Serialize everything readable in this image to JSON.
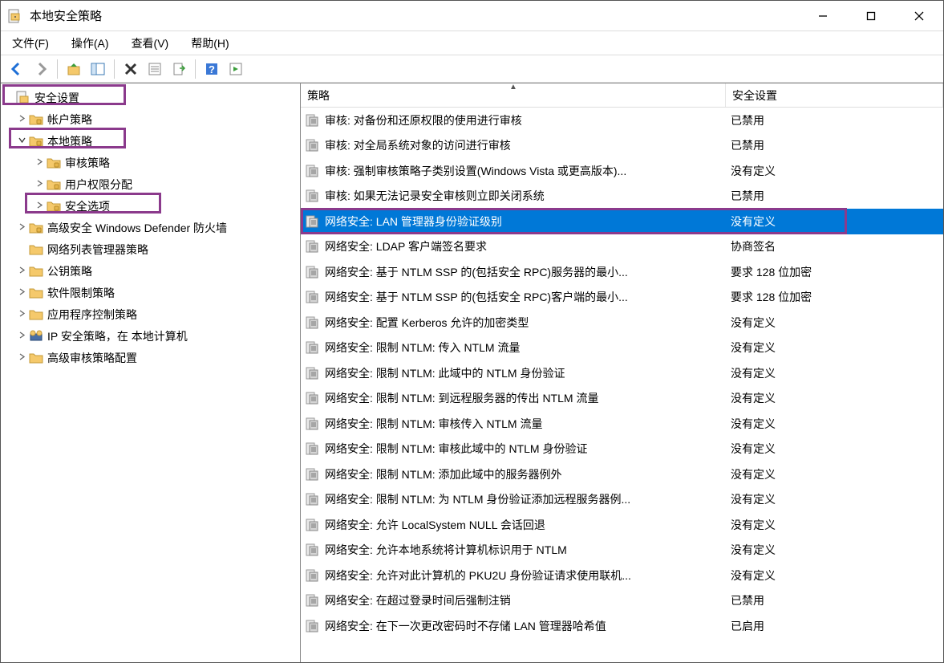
{
  "window": {
    "title": "本地安全策略"
  },
  "menu": {
    "file": "文件(F)",
    "action": "操作(A)",
    "view": "查看(V)",
    "help": "帮助(H)"
  },
  "columns": {
    "policy": "策略",
    "setting": "安全设置"
  },
  "tree": [
    {
      "id": "root",
      "label": "安全设置",
      "indent": 0,
      "expander": "",
      "icon": "root"
    },
    {
      "id": "acct",
      "label": "帐户策略",
      "indent": 1,
      "expander": "›",
      "icon": "folder"
    },
    {
      "id": "local",
      "label": "本地策略",
      "indent": 1,
      "expander": "⌄",
      "icon": "folder"
    },
    {
      "id": "audit",
      "label": "审核策略",
      "indent": 2,
      "expander": "›",
      "icon": "folder"
    },
    {
      "id": "rights",
      "label": "用户权限分配",
      "indent": 2,
      "expander": "›",
      "icon": "folder"
    },
    {
      "id": "secopts",
      "label": "安全选项",
      "indent": 2,
      "expander": "›",
      "icon": "folder"
    },
    {
      "id": "defender",
      "label": "高级安全 Windows Defender 防火墙",
      "indent": 1,
      "expander": "›",
      "icon": "folder"
    },
    {
      "id": "netlist",
      "label": "网络列表管理器策略",
      "indent": 1,
      "expander": "",
      "icon": "folder-plain"
    },
    {
      "id": "pubkey",
      "label": "公钥策略",
      "indent": 1,
      "expander": "›",
      "icon": "folder-plain"
    },
    {
      "id": "swrestrict",
      "label": "软件限制策略",
      "indent": 1,
      "expander": "›",
      "icon": "folder-plain"
    },
    {
      "id": "appctrl",
      "label": "应用程序控制策略",
      "indent": 1,
      "expander": "›",
      "icon": "folder-plain"
    },
    {
      "id": "ipsec",
      "label": "IP 安全策略，在 本地计算机",
      "indent": 1,
      "expander": "›",
      "icon": "ipsec"
    },
    {
      "id": "advaudit",
      "label": "高级审核策略配置",
      "indent": 1,
      "expander": "›",
      "icon": "folder-plain"
    }
  ],
  "rows": [
    {
      "policy": "审核: 对备份和还原权限的使用进行审核",
      "setting": "已禁用",
      "selected": false
    },
    {
      "policy": "审核: 对全局系统对象的访问进行审核",
      "setting": "已禁用",
      "selected": false
    },
    {
      "policy": "审核: 强制审核策略子类别设置(Windows Vista 或更高版本)...",
      "setting": "没有定义",
      "selected": false
    },
    {
      "policy": "审核: 如果无法记录安全审核则立即关闭系统",
      "setting": "已禁用",
      "selected": false
    },
    {
      "policy": "网络安全: LAN 管理器身份验证级别",
      "setting": "没有定义",
      "selected": true
    },
    {
      "policy": "网络安全: LDAP 客户端签名要求",
      "setting": "协商签名",
      "selected": false
    },
    {
      "policy": "网络安全: 基于 NTLM SSP 的(包括安全 RPC)服务器的最小...",
      "setting": "要求 128 位加密",
      "selected": false
    },
    {
      "policy": "网络安全: 基于 NTLM SSP 的(包括安全 RPC)客户端的最小...",
      "setting": "要求 128 位加密",
      "selected": false
    },
    {
      "policy": "网络安全: 配置 Kerberos 允许的加密类型",
      "setting": "没有定义",
      "selected": false
    },
    {
      "policy": "网络安全: 限制 NTLM: 传入 NTLM 流量",
      "setting": "没有定义",
      "selected": false
    },
    {
      "policy": "网络安全: 限制 NTLM: 此域中的 NTLM 身份验证",
      "setting": "没有定义",
      "selected": false
    },
    {
      "policy": "网络安全: 限制 NTLM: 到远程服务器的传出 NTLM 流量",
      "setting": "没有定义",
      "selected": false
    },
    {
      "policy": "网络安全: 限制 NTLM: 审核传入 NTLM 流量",
      "setting": "没有定义",
      "selected": false
    },
    {
      "policy": "网络安全: 限制 NTLM: 审核此域中的 NTLM 身份验证",
      "setting": "没有定义",
      "selected": false
    },
    {
      "policy": "网络安全: 限制 NTLM: 添加此域中的服务器例外",
      "setting": "没有定义",
      "selected": false
    },
    {
      "policy": "网络安全: 限制 NTLM: 为 NTLM 身份验证添加远程服务器例...",
      "setting": "没有定义",
      "selected": false
    },
    {
      "policy": "网络安全: 允许 LocalSystem NULL 会话回退",
      "setting": "没有定义",
      "selected": false
    },
    {
      "policy": "网络安全: 允许本地系统将计算机标识用于 NTLM",
      "setting": "没有定义",
      "selected": false
    },
    {
      "policy": "网络安全: 允许对此计算机的 PKU2U 身份验证请求使用联机...",
      "setting": "没有定义",
      "selected": false
    },
    {
      "policy": "网络安全: 在超过登录时间后强制注销",
      "setting": "已禁用",
      "selected": false
    },
    {
      "policy": "网络安全: 在下一次更改密码时不存储 LAN 管理器哈希值",
      "setting": "已启用",
      "selected": false
    }
  ]
}
